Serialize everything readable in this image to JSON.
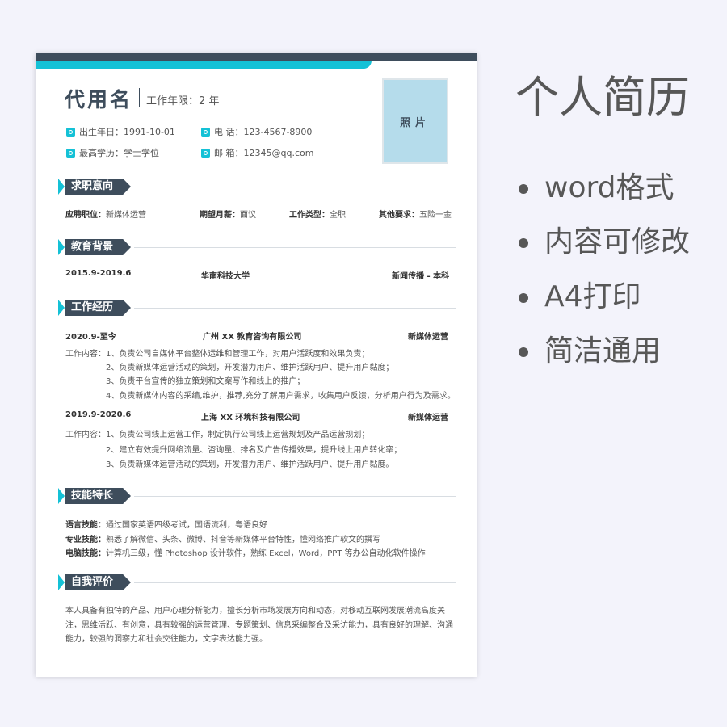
{
  "resume": {
    "name": "代用名",
    "years": "工作年限：2 年",
    "photo": "照片",
    "info": {
      "birth": "出生年日：1991-10-01",
      "phone": "电 话：123-4567-8900",
      "degree": "最高学历：学士学位",
      "email": "邮 箱：12345@qq.com"
    },
    "sections": {
      "job": "求职意向",
      "edu": "教育背景",
      "work": "工作经历",
      "skills": "技能特长",
      "self": "自我评价"
    },
    "job": {
      "position_label": "应聘职位：",
      "position": "新媒体运营",
      "salary_label": "期望月薪：",
      "salary": "面议",
      "type_label": "工作类型：",
      "type": "全职",
      "other_label": "其他要求：",
      "other": "五险一金"
    },
    "edu": {
      "period": "2015.9-2019.6",
      "school": "华南科技大学",
      "major": "新闻传播 - 本科"
    },
    "work": [
      {
        "period": "2020.9-至今",
        "company": "广州 XX 教育咨询有限公司",
        "role": "新媒体运营",
        "lines": [
          "工作内容：1、负责公司自媒体平台整体运维和管理工作，对用户活跃度和效果负责；",
          "2、负责新媒体运营活动的策划，开发潜力用户、维护活跃用户、提升用户黏度；",
          "3、负责平台宣传的独立策划和文案写作和线上的推广；",
          "4、负责新媒体内容的采编,维护，推荐,充分了解用户需求，收集用户反馈，分析用户行为及需求。"
        ]
      },
      {
        "period": "2019.9-2020.6",
        "company": "上海 XX 环境科技有限公司",
        "role": "新媒体运营",
        "lines": [
          "工作内容：1、负责公司线上运营工作，制定执行公司线上运营规划及产品运营规划；",
          "2、建立有效提升网络流量、咨询量、排名及广告传播效果，提升线上用户转化率；",
          "3、负责新媒体运营活动的策划，开发潜力用户、维护活跃用户、提升用户黏度。"
        ]
      }
    ],
    "skills": [
      {
        "label": "语言技能：",
        "text": "通过国家英语四级考试，国语流利，粤语良好"
      },
      {
        "label": "专业技能：",
        "text": "熟悉了解微信、头条、微博、抖音等新媒体平台特性，懂网络推广软文的撰写"
      },
      {
        "label": "电脑技能：",
        "text": "计算机三级，懂 Photoshop 设计软件，熟练 Excel，Word，PPT 等办公自动化软件操作"
      }
    ],
    "self_eval": "本人具备有独特的产品、用户心理分析能力，擅长分析市场发展方向和动态，对移动互联网发展潮流高度关注，思维活跃、有创意，具有较强的运营管理、专题策划、信息采编整合及采访能力，具有良好的理解、沟通能力，较强的洞察力和社会交往能力，文字表达能力强。"
  },
  "promo": {
    "title": "个人简历",
    "bullets": [
      "word格式",
      "内容可修改",
      "A4打印",
      "简洁通用"
    ]
  },
  "colors": {
    "accent": "#14c1d6",
    "dark": "#3e4d5c",
    "photo_bg": "#b5dceb"
  }
}
